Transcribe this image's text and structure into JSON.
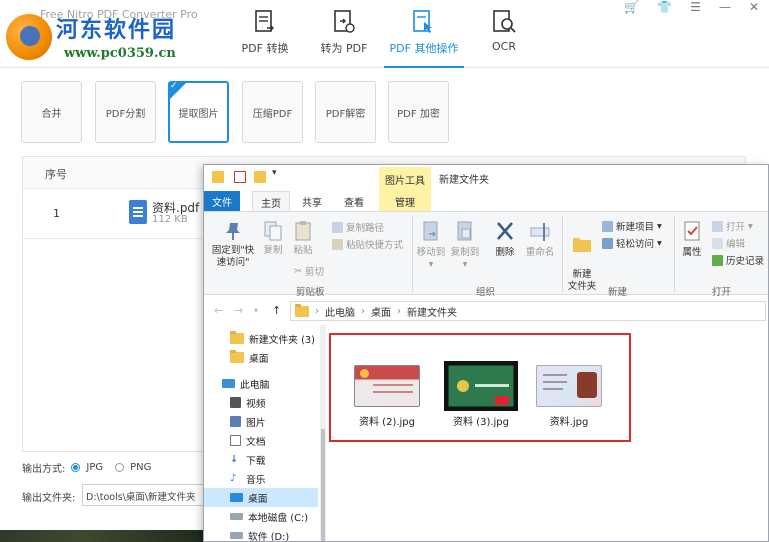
{
  "app": {
    "faded_title": "Free Nitro PDF Converter Pro",
    "logo_text": "河东软件园",
    "logo_url": "www.pc0359.cn",
    "nav_tabs": [
      {
        "label": "PDF 转换",
        "icon": "pdf-convert-icon"
      },
      {
        "label": "转为 PDF",
        "icon": "to-pdf-icon"
      },
      {
        "label": "PDF 其他操作",
        "icon": "pdf-other-ops-icon",
        "active": true
      },
      {
        "label": "OCR",
        "icon": "ocr-icon"
      }
    ],
    "window_controls": [
      "🛒",
      "👕",
      "☰",
      "—",
      "✕"
    ],
    "functions": [
      {
        "label": "合并"
      },
      {
        "label": "PDF分割"
      },
      {
        "label": "提取图片",
        "active": true
      },
      {
        "label": "压缩PDF"
      },
      {
        "label": "PDF解密"
      },
      {
        "label": "PDF 加密"
      }
    ],
    "table": {
      "header_index": "序号",
      "rows": [
        {
          "index": "1",
          "name": "资料.pdf",
          "size": "112 KB"
        }
      ]
    },
    "output": {
      "mode_label": "输出方式:",
      "option_jpg": "JPG",
      "option_png": "PNG",
      "selected": "JPG",
      "folder_label": "输出文件夹:",
      "folder_value": "D:\\tools\\桌面\\新建文件夹"
    }
  },
  "explorer": {
    "context_tab_header": "图片工具",
    "window_title": "新建文件夹",
    "tabs": {
      "file": "文件",
      "home": "主页",
      "share": "共享",
      "view": "查看",
      "manage": "管理"
    },
    "ribbon": {
      "pin": "固定到\"快速访问\"",
      "copy": "复制",
      "paste": "粘贴",
      "copy_path": "复制路径",
      "paste_shortcut": "粘贴快捷方式",
      "cut": "剪切",
      "clipboard_group": "剪贴板",
      "move_to": "移动到",
      "copy_to": "复制到",
      "delete": "删除",
      "rename": "重命名",
      "organize_group": "组织",
      "new_folder": "新建\n文件夹",
      "new_item": "新建项目",
      "easy_access": "轻松访问",
      "new_group": "新建",
      "properties": "属性",
      "open": "打开",
      "edit": "编辑",
      "history": "历史记录",
      "open_group": "打开"
    },
    "address": {
      "parts": [
        "此电脑",
        "桌面",
        "新建文件夹"
      ]
    },
    "nav_items": [
      {
        "label": "新建文件夹 (3)",
        "icon": "folder-icon"
      },
      {
        "label": "桌面",
        "icon": "folder-icon"
      },
      {
        "label": "此电脑",
        "icon": "computer-icon"
      },
      {
        "label": "视频",
        "icon": "video-icon"
      },
      {
        "label": "图片",
        "icon": "pictures-icon"
      },
      {
        "label": "文档",
        "icon": "documents-icon"
      },
      {
        "label": "下载",
        "icon": "downloads-icon"
      },
      {
        "label": "音乐",
        "icon": "music-icon"
      },
      {
        "label": "桌面",
        "icon": "desktop-icon",
        "selected": true
      },
      {
        "label": "本地磁盘 (C:)",
        "icon": "drive-icon"
      },
      {
        "label": "软件 (D:)",
        "icon": "drive-icon"
      }
    ],
    "files": [
      {
        "name": "资料 (2).jpg"
      },
      {
        "name": "资料 (3).jpg"
      },
      {
        "name": "资料.jpg"
      }
    ]
  }
}
